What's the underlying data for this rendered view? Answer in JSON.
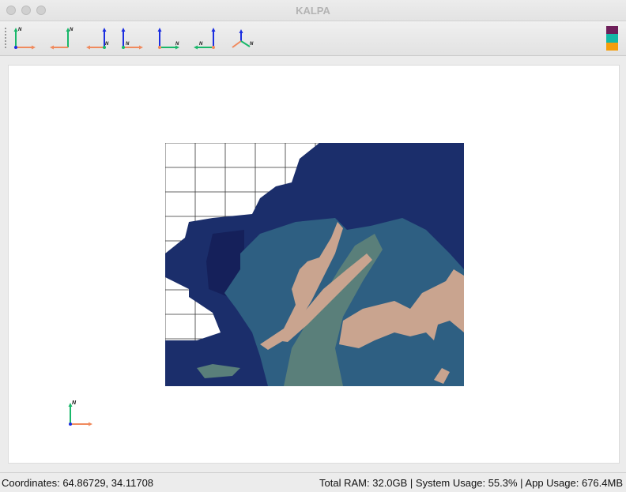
{
  "window": {
    "title": "KALPA"
  },
  "toolbar": {
    "tools": [
      {
        "name": "view-north-up-left",
        "label": "N"
      },
      {
        "name": "view-north-up-right",
        "label": "N"
      },
      {
        "name": "view-north-up-center",
        "label": "N"
      },
      {
        "name": "view-north-up-both",
        "label": "N"
      },
      {
        "name": "view-north-up-east",
        "label": "N"
      },
      {
        "name": "view-north-up-west",
        "label": "N"
      },
      {
        "name": "view-perspective",
        "label": "N"
      }
    ],
    "palette_colors": [
      "#6e1f5a",
      "#14b8a6",
      "#f59e0b"
    ]
  },
  "map": {
    "colors": {
      "deep": "#1b2e6b",
      "mid": "#2e5f82",
      "shallow": "#5a7f7a",
      "land": "#c9a48f",
      "grid": "#333333"
    }
  },
  "compass": {
    "label": "N"
  },
  "status": {
    "coordinates": "Coordinates: 64.86729, 34.11708",
    "system": "Total RAM: 32.0GB | System Usage: 55.3% | App Usage: 676.4MB"
  }
}
